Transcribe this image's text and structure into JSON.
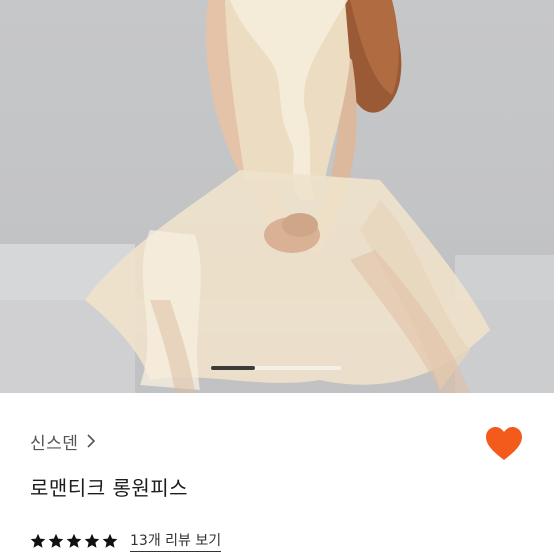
{
  "product": {
    "seller_name": "신스덴",
    "title": "로맨티크 롱원피스",
    "rating": 5,
    "rating_max": 5,
    "review_link_label": "13개 리뷰 보기"
  },
  "carousel": {
    "progress_fraction": 0.34
  },
  "icons": {
    "seller_arrow": "chevron-right-icon",
    "like": "heart-icon",
    "star": "star-icon"
  },
  "colors": {
    "heart": "#f35b1d",
    "stars": "#111111",
    "title": "#1c1c1c",
    "seller": "#555555",
    "carousel_indicator": "#3b3b3b"
  }
}
